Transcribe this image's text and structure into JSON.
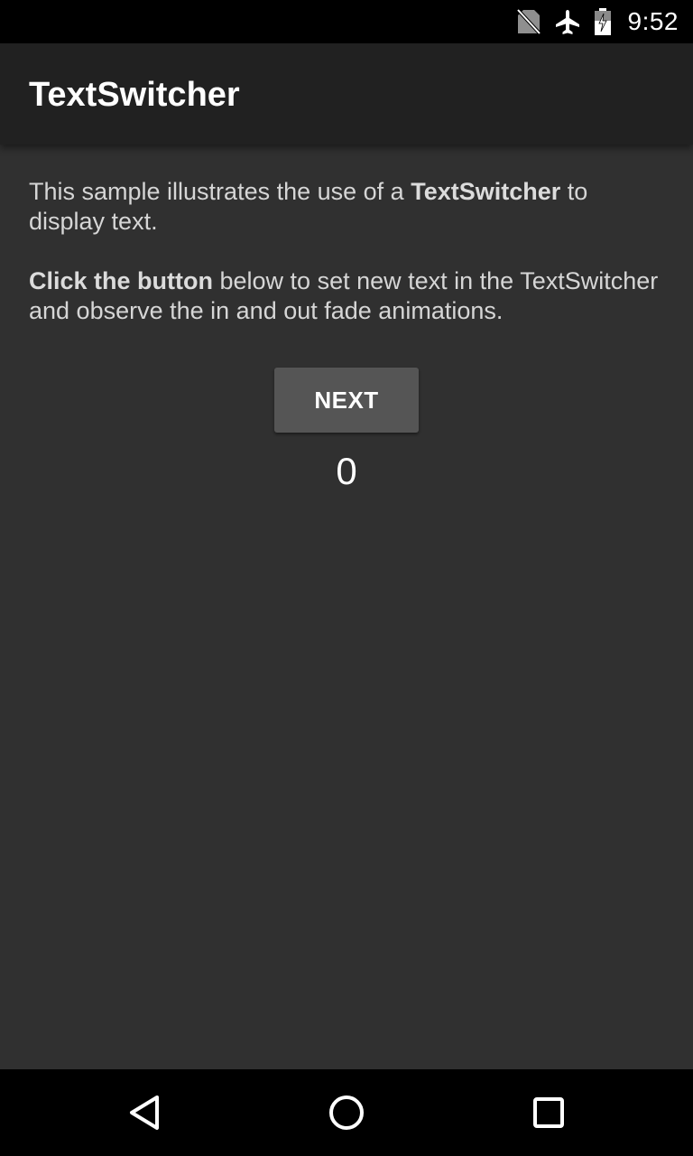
{
  "status_bar": {
    "time": "9:52",
    "icons": [
      "no-sim-icon",
      "airplane-mode-icon",
      "battery-icon"
    ]
  },
  "app_bar": {
    "title": "TextSwitcher"
  },
  "intro": {
    "line1_before": "This sample illustrates the use of a ",
    "line1_bold": "TextSwitcher",
    "line1_after": " to display text.",
    "line2_bold": "Click the button",
    "line2_after": " below to set new text in the TextSwitcher and observe the in and out fade animations."
  },
  "next_button": {
    "label": "NEXT"
  },
  "counter": {
    "value": "0"
  },
  "nav_bar": {
    "buttons": [
      "back-icon",
      "home-icon",
      "recents-icon"
    ]
  },
  "colors": {
    "background": "#303030",
    "app_bar": "#212121",
    "button": "#555555"
  }
}
